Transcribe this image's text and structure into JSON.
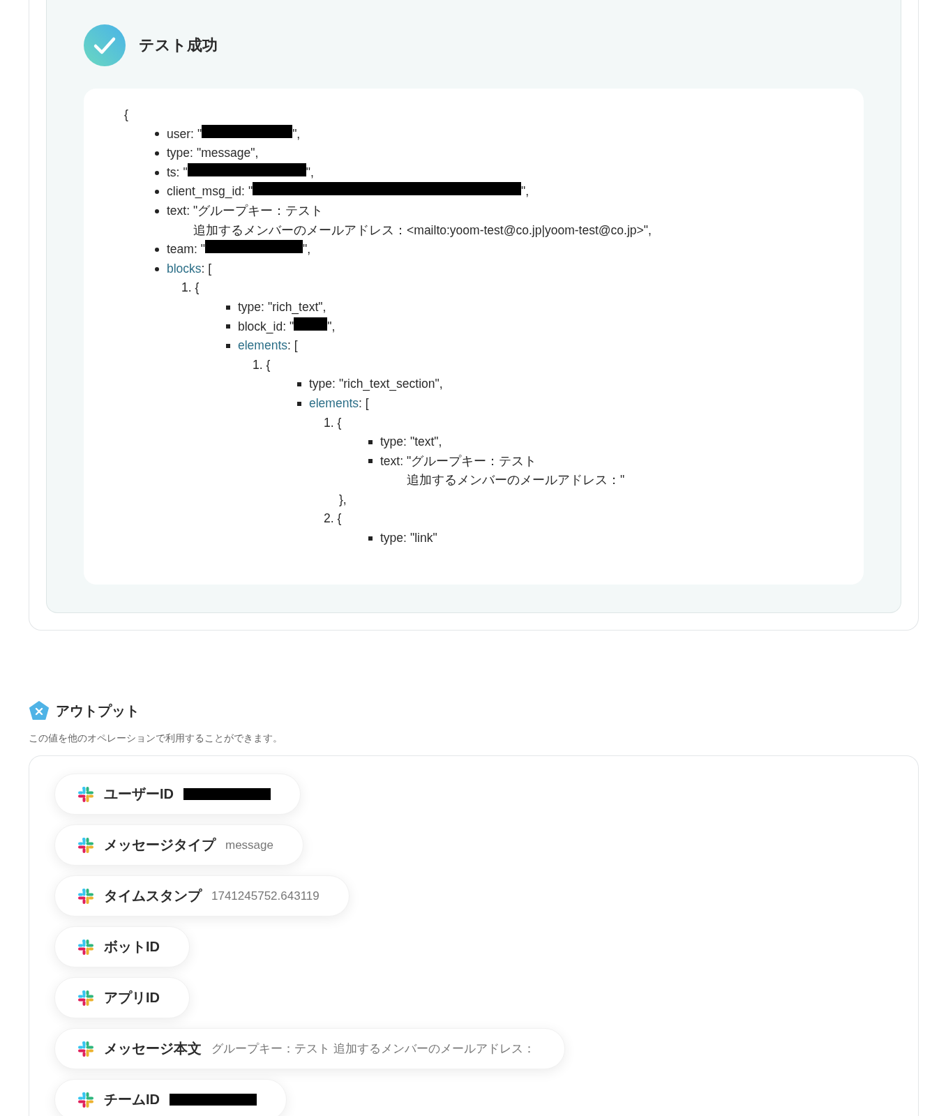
{
  "result": {
    "title": "テスト成功",
    "code": {
      "open": "{",
      "items": [
        {
          "kind": "field",
          "label": "user:",
          "value": "\"",
          "redacted": true,
          "after": "\","
        },
        {
          "kind": "field",
          "label": "type:",
          "value": "\"message\","
        },
        {
          "kind": "field",
          "label": "ts:",
          "value": "\"",
          "redacted": true,
          "after": "\","
        },
        {
          "kind": "field",
          "label": "client_msg_id:",
          "value": "\"",
          "redacted": true,
          "after": "\","
        },
        {
          "kind": "field",
          "label": "text:",
          "lines": [
            "\"グループキー：テスト",
            "追加するメンバーのメールアドレス：<mailto:yoom-test@co.jp|yoom-test@co.jp>\","
          ]
        },
        {
          "kind": "field",
          "label": "team:",
          "value": "\"",
          "redacted": true,
          "after": "\","
        },
        {
          "kind": "array",
          "label": "blocks",
          "value": ": [",
          "entries": [
            {
              "number": "1.",
              "open": "{",
              "items": [
                {
                  "kind": "field",
                  "label": "type:",
                  "value": "\"rich_text\","
                },
                {
                  "kind": "field",
                  "label": "block_id:",
                  "value": "\"",
                  "redacted": true,
                  "after": "\","
                },
                {
                  "kind": "array",
                  "label": "elements",
                  "value": ": [",
                  "entries": [
                    {
                      "number": "1.",
                      "open": "{",
                      "items": [
                        {
                          "kind": "field",
                          "label": "type:",
                          "value": "\"rich_text_section\","
                        },
                        {
                          "kind": "array",
                          "label": "elements",
                          "value": ": [",
                          "entries": [
                            {
                              "number": "1.",
                              "open": "{",
                              "items": [
                                {
                                  "kind": "field",
                                  "label": "type:",
                                  "value": "\"text\","
                                },
                                {
                                  "kind": "field",
                                  "label": "text:",
                                  "lines": [
                                    "\"グループキー：テスト",
                                    "追加するメンバーのメールアドレス：\""
                                  ]
                                }
                              ],
                              "close": "},"
                            },
                            {
                              "number": "2.",
                              "open": "{",
                              "items": [
                                {
                                  "kind": "field",
                                  "label": "type:",
                                  "value": "\"link\""
                                }
                              ]
                            }
                          ]
                        }
                      ]
                    }
                  ]
                }
              ]
            }
          ]
        }
      ]
    }
  },
  "output": {
    "title": "アウトプット",
    "description": "この値を他のオペレーションで利用することができます。",
    "items": [
      {
        "label": "ユーザーID",
        "redacted": true
      },
      {
        "label": "メッセージタイプ",
        "value": "message"
      },
      {
        "label": "タイムスタンプ",
        "value": "1741245752.643119"
      },
      {
        "label": "ボットID"
      },
      {
        "label": "アプリID"
      },
      {
        "label": "メッセージ本文",
        "value": "グループキー：テスト 追加するメンバーのメールアドレス："
      },
      {
        "label": "チームID",
        "redacted": true
      }
    ]
  }
}
